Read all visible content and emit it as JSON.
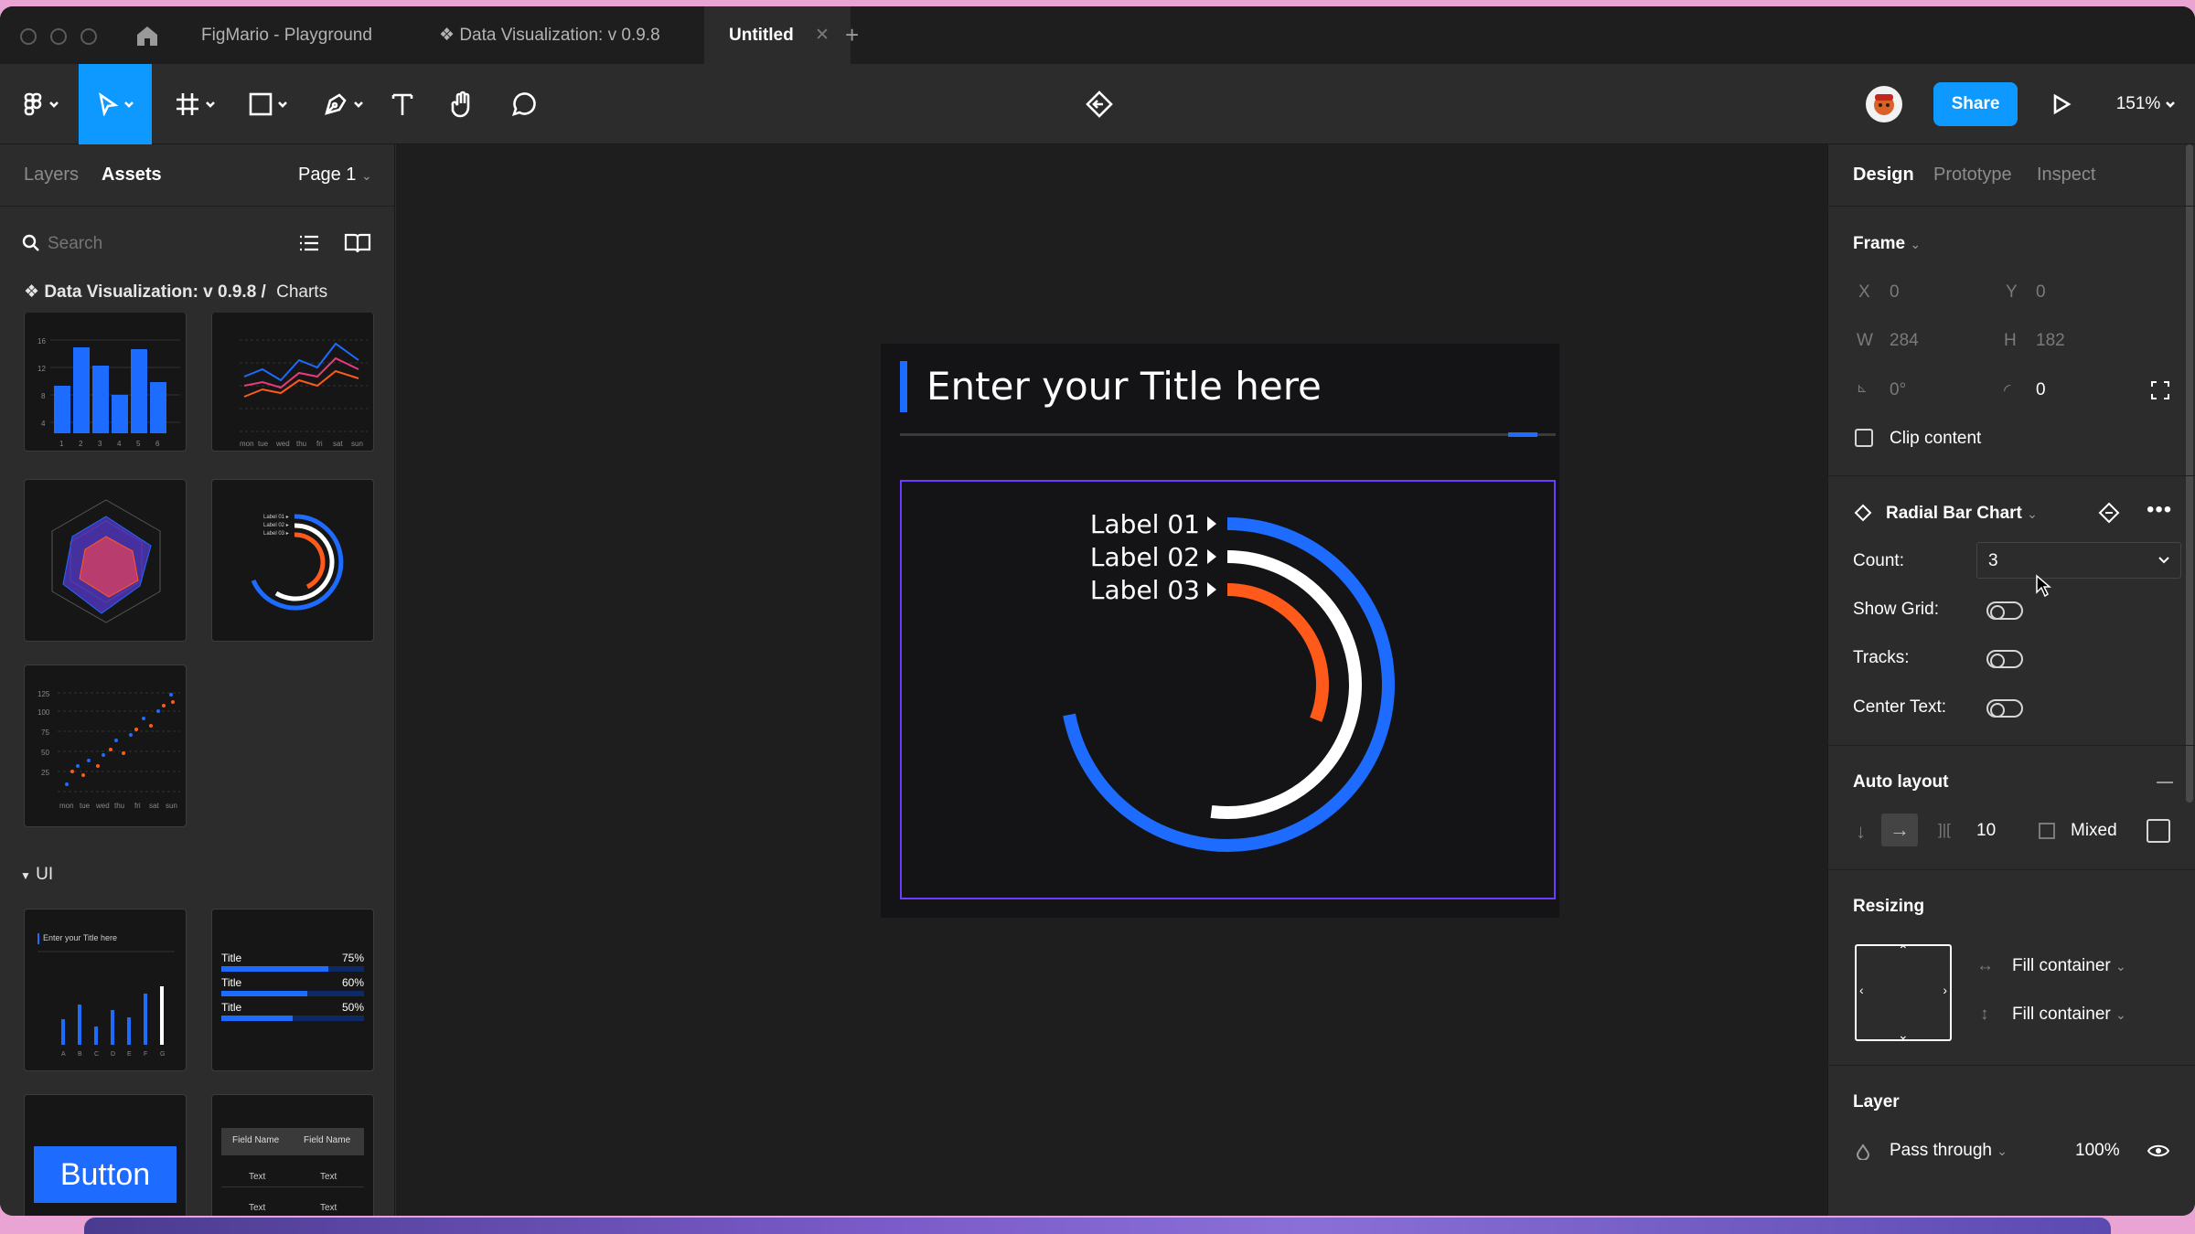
{
  "tabs": [
    {
      "label": "FigMario - Playground"
    },
    {
      "label": "Data Visualization: v 0.9.8"
    },
    {
      "label": "Untitled"
    }
  ],
  "toolbar": {
    "share_label": "Share",
    "zoom": "151%"
  },
  "left_panel": {
    "tabs": [
      "Layers",
      "Assets"
    ],
    "page": "Page 1",
    "search_placeholder": "Search",
    "breadcrumb_lib": "Data Visualization: v 0.9.8 /",
    "breadcrumb_section": "Charts",
    "ui_section": "UI",
    "button_thumb_label": "Button",
    "progress_thumb": [
      {
        "label": "Title",
        "value": "75%",
        "fill": 0.75
      },
      {
        "label": "Title",
        "value": "60%",
        "fill": 0.6
      },
      {
        "label": "Title",
        "value": "50%",
        "fill": 0.5
      }
    ],
    "table_thumb": {
      "header": [
        "Field Name",
        "Field Name"
      ],
      "cell": "Text"
    },
    "title_thumb": "Enter your Title here"
  },
  "canvas": {
    "card_title": "Enter your Title here",
    "labels": [
      "Label 01",
      "Label 02",
      "Label 03"
    ]
  },
  "chart_data": {
    "type": "radial-bar",
    "categories": [
      "Label 01",
      "Label 02",
      "Label 03"
    ],
    "values": [
      0.72,
      0.52,
      0.31
    ],
    "colors": [
      "#1e6bff",
      "#ffffff",
      "#ff5a1a"
    ]
  },
  "right_panel": {
    "tabs": [
      "Design",
      "Prototype",
      "Inspect"
    ],
    "frame": {
      "title": "Frame",
      "x_label": "X",
      "x": "0",
      "y_label": "Y",
      "y": "0",
      "w_label": "W",
      "w": "284",
      "h_label": "H",
      "h": "182",
      "rotation": "0°",
      "radius": "0",
      "clip": "Clip content"
    },
    "component": {
      "name": "Radial Bar Chart",
      "count_label": "Count:",
      "count": "3",
      "grid_label": "Show Grid:",
      "tracks_label": "Tracks:",
      "center_label": "Center Text:"
    },
    "auto_layout": {
      "title": "Auto layout",
      "spacing": "10",
      "padding": "Mixed"
    },
    "resizing": {
      "title": "Resizing",
      "h": "Fill container",
      "v": "Fill container"
    },
    "layer": {
      "title": "Layer",
      "blend": "Pass through",
      "opacity": "100%"
    }
  }
}
